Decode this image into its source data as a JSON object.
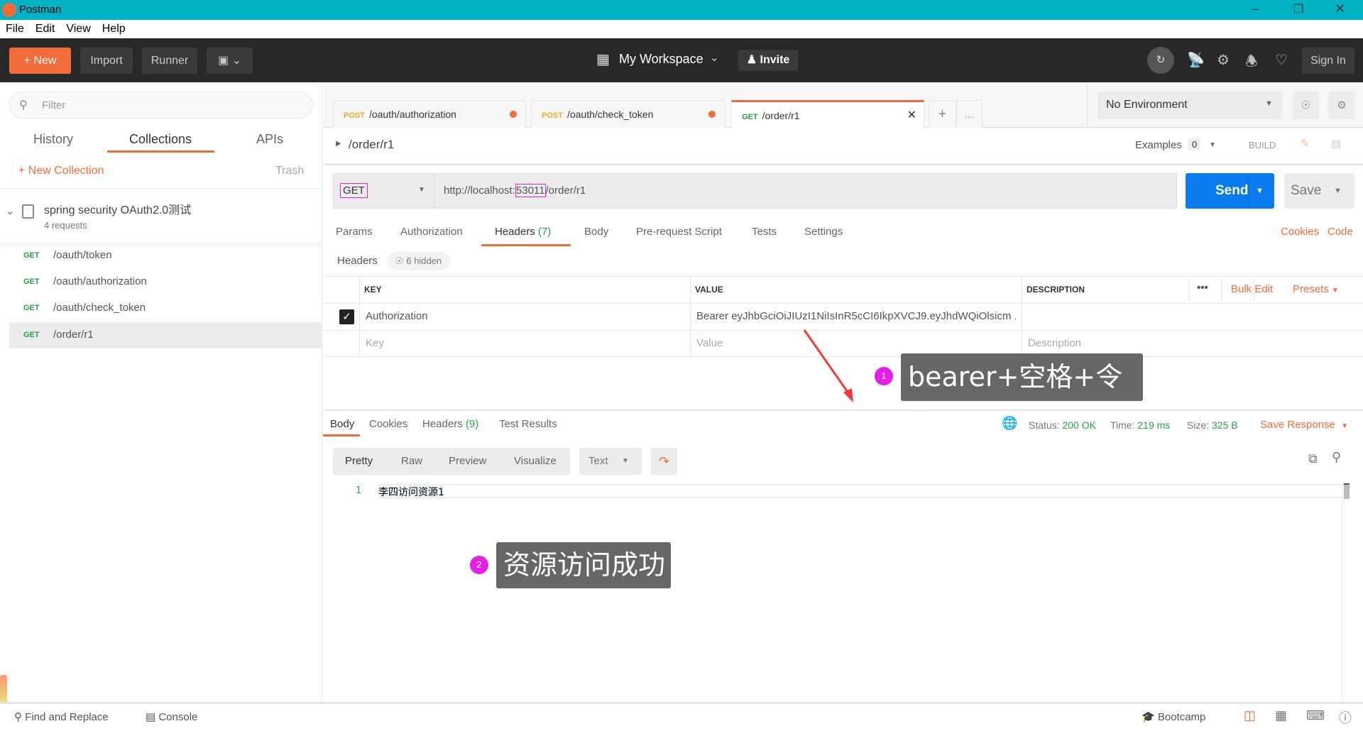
{
  "window": {
    "title": "Postman",
    "controls": [
      "minimize",
      "restore",
      "close"
    ]
  },
  "menu": [
    "File",
    "Edit",
    "View",
    "Help"
  ],
  "header": {
    "new": "New",
    "import": "Import",
    "runner": "Runner",
    "workspace": "My Workspace",
    "invite": "Invite",
    "sign_in": "Sign In"
  },
  "sidebar": {
    "filter_placeholder": "Filter",
    "tabs": [
      "History",
      "Collections",
      "APIs"
    ],
    "active_tab": "Collections",
    "new_collection": "New Collection",
    "trash": "Trash",
    "collection": {
      "name": "spring security OAuth2.0测试",
      "count": "4 requests"
    },
    "requests": [
      {
        "method": "GET",
        "path": "/oauth/token"
      },
      {
        "method": "GET",
        "path": "/oauth/authorization"
      },
      {
        "method": "GET",
        "path": "/oauth/check_token"
      },
      {
        "method": "GET",
        "path": "/order/r1",
        "selected": true
      }
    ]
  },
  "tabs": [
    {
      "method": "POST",
      "path": "/oauth/authorization",
      "unsaved": true
    },
    {
      "method": "POST",
      "path": "/oauth/check_token",
      "unsaved": true
    },
    {
      "method": "GET",
      "path": "/order/r1",
      "active": true
    }
  ],
  "environment": {
    "selected": "No Environment"
  },
  "request": {
    "name": "/order/r1",
    "examples_label": "Examples",
    "examples_count": "0",
    "build": "BUILD",
    "method": "GET",
    "url_prefix": "http://localhost:",
    "url_port": "53011",
    "url_suffix": "/order/r1",
    "send": "Send",
    "save": "Save",
    "tabs": [
      {
        "label": "Params"
      },
      {
        "label": "Authorization"
      },
      {
        "label": "Headers",
        "count": "(7)",
        "active": true
      },
      {
        "label": "Body"
      },
      {
        "label": "Pre-request Script"
      },
      {
        "label": "Tests"
      },
      {
        "label": "Settings"
      }
    ],
    "cookies": "Cookies",
    "code": "Code",
    "headers_label": "Headers",
    "hidden": "6 hidden",
    "table": {
      "columns": [
        "KEY",
        "VALUE",
        "DESCRIPTION"
      ],
      "bulk_edit": "Bulk Edit",
      "presets": "Presets",
      "rows": [
        {
          "checked": true,
          "key": "Authorization",
          "value": "Bearer eyJhbGciOiJIUzI1NiIsInR5cCI6IkpXVCJ9.eyJhdWQiOlsicm ..."
        }
      ],
      "placeholder": {
        "key": "Key",
        "value": "Value",
        "description": "Description"
      }
    }
  },
  "response": {
    "tabs": [
      {
        "label": "Body",
        "active": true
      },
      {
        "label": "Cookies"
      },
      {
        "label": "Headers",
        "count": "(9)"
      },
      {
        "label": "Test Results"
      }
    ],
    "status_label": "Status:",
    "status": "200 OK",
    "time_label": "Time:",
    "time": "219 ms",
    "size_label": "Size:",
    "size": "325 B",
    "save_response": "Save Response",
    "views": [
      "Pretty",
      "Raw",
      "Preview",
      "Visualize"
    ],
    "format": "Text",
    "lines": [
      {
        "n": "1",
        "text": "李四访问资源1"
      }
    ]
  },
  "annotations": [
    {
      "n": "1",
      "text": "bearer+空格+令牌"
    },
    {
      "n": "2",
      "text": "资源访问成功"
    }
  ],
  "footer": {
    "find_replace": "Find and Replace",
    "console": "Console",
    "bootcamp": "Bootcamp"
  },
  "colors": {
    "accent": "#f26b3a",
    "send": "#097bed",
    "titlebar": "#00b3c4",
    "success": "#2a9d4a",
    "highlight": "#e61ee6"
  }
}
